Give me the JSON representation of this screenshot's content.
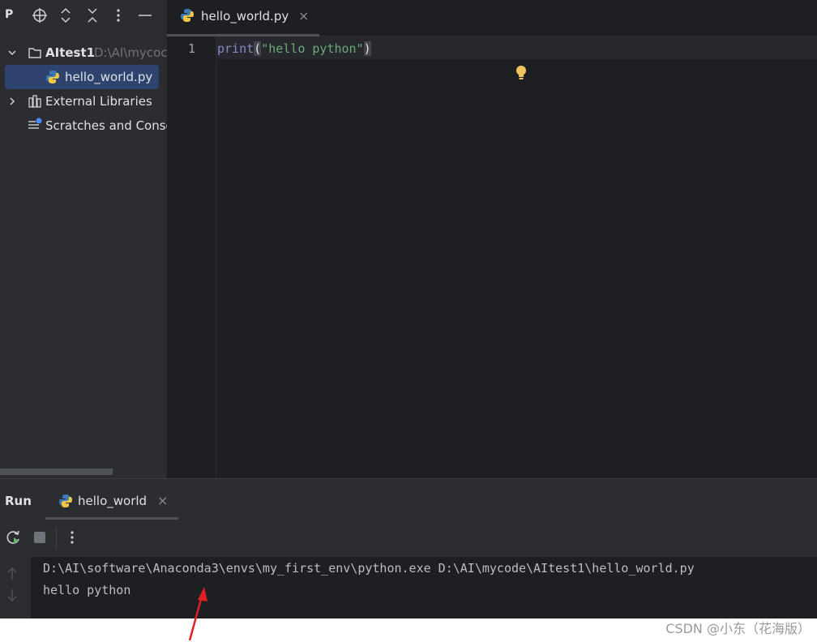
{
  "project_panel": {
    "title": "P",
    "tree": {
      "root_name": "AItest1",
      "root_path": "D:\\AI\\mycoc",
      "file": "hello_world.py",
      "external": "External Libraries",
      "scratches": "Scratches and Conso"
    }
  },
  "editor": {
    "tab_label": "hello_world.py",
    "tab_close": "×",
    "line_number": "1",
    "code": {
      "keyword": "print",
      "open_paren": "(",
      "string": "\"hello python\"",
      "close_paren": ")"
    }
  },
  "run_panel": {
    "title": "Run",
    "tab_label": "hello_world",
    "tab_close": "×",
    "console_lines": [
      "D:\\AI\\software\\Anaconda3\\envs\\my_first_env\\python.exe D:\\AI\\mycode\\AItest1\\hello_world.py",
      "hello python"
    ]
  },
  "watermark": "CSDN @小东（花海版）",
  "colors": {
    "background": "#1e1f22",
    "panel": "#2b2d30",
    "selection": "#2e436e",
    "keyword": "#8888c6",
    "string": "#6aab73",
    "arrow": "#e02020"
  }
}
